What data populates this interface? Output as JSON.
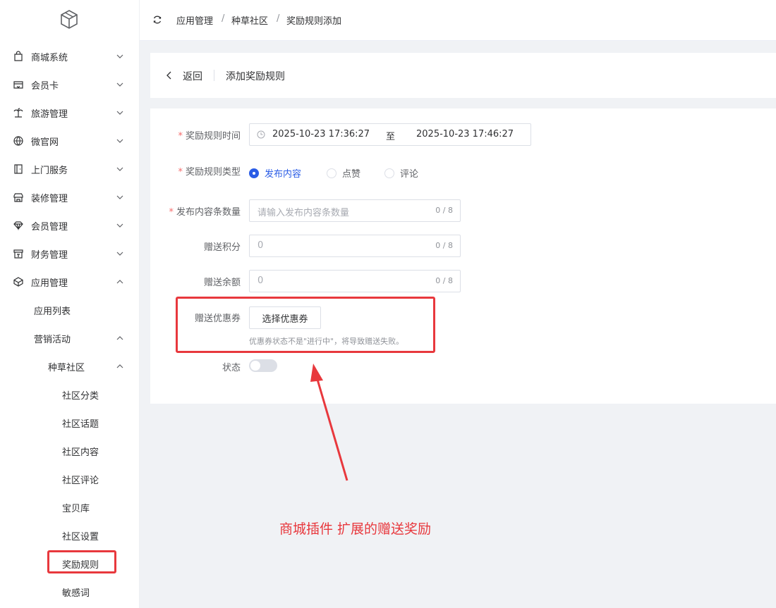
{
  "sidebar": {
    "logo": "cube-logo",
    "menus": [
      {
        "label": "商城系统",
        "icon": "shopping-bag-icon",
        "expanded": false
      },
      {
        "label": "会员卡",
        "icon": "card-icon",
        "expanded": false
      },
      {
        "label": "旅游管理",
        "icon": "palm-tree-icon",
        "expanded": false
      },
      {
        "label": "微官网",
        "icon": "globe-icon",
        "expanded": false
      },
      {
        "label": "上门服务",
        "icon": "door-icon",
        "expanded": false
      },
      {
        "label": "装修管理",
        "icon": "store-icon",
        "expanded": false
      },
      {
        "label": "会员管理",
        "icon": "diamond-icon",
        "expanded": false
      },
      {
        "label": "财务管理",
        "icon": "finance-icon",
        "expanded": false
      },
      {
        "label": "应用管理",
        "icon": "cube-icon",
        "expanded": true
      }
    ],
    "app_list": "应用列表",
    "marketing": "营销活动",
    "community": "种草社区",
    "community_items": [
      "社区分类",
      "社区话题",
      "社区内容",
      "社区评论",
      "宝贝库",
      "社区设置",
      "奖励规则",
      "敏感词"
    ],
    "active_item": "奖励规则"
  },
  "header": {
    "breadcrumb": [
      "应用管理",
      "种草社区",
      "奖励规则添加"
    ],
    "separator": "/"
  },
  "page_head": {
    "back_label": "返回",
    "title": "添加奖励规则"
  },
  "form": {
    "time_label": "奖励规则时间",
    "start_time": "2025-10-23 17:36:27",
    "range_sep": "至",
    "end_time": "2025-10-23 17:46:27",
    "type_label": "奖励规则类型",
    "type_options": [
      "发布内容",
      "点赞",
      "评论"
    ],
    "type_selected": "发布内容",
    "count_label": "发布内容条数量",
    "count_placeholder": "请输入发布内容条数量",
    "count_limit": "0 / 8",
    "points_label": "赠送积分",
    "points_value": "0",
    "points_limit": "0 / 8",
    "balance_label": "赠送余额",
    "balance_value": "0",
    "balance_limit": "0 / 8",
    "coupon_label": "赠送优惠券",
    "coupon_button": "选择优惠券",
    "coupon_tip": "优惠券状态不是\"进行中\"，将导致赠送失败。",
    "status_label": "状态",
    "status_on": false,
    "required_mark": "*"
  },
  "annotation": {
    "text": "商城插件 扩展的赠送奖励",
    "color": "#e8383d"
  },
  "colors": {
    "primary": "#2a5ce6",
    "highlight": "#e8383d",
    "required": "#f56c6c"
  }
}
